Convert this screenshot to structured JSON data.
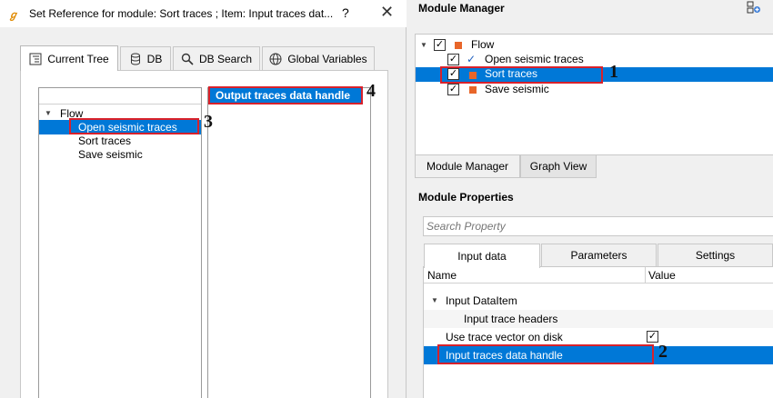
{
  "dialog": {
    "title": "Set Reference for module: Sort traces ; Item: Input traces dat...",
    "help_label": "?",
    "close_label": "✕",
    "tabs": [
      {
        "label": "Current Tree",
        "icon": "tree-icon",
        "active": true
      },
      {
        "label": "DB",
        "icon": "database-icon",
        "active": false
      },
      {
        "label": "DB Search",
        "icon": "search-icon",
        "active": false
      },
      {
        "label": "Global Variables",
        "icon": "globe-icon",
        "active": false
      }
    ],
    "tree": {
      "root": "Flow",
      "items": [
        "Open seismic traces",
        "Sort traces",
        "Save seismic"
      ],
      "selected": "Open seismic traces"
    },
    "handles": {
      "items": [
        "Output traces data handle"
      ],
      "selected": "Output traces data handle"
    }
  },
  "module_manager": {
    "title": "Module Manager",
    "tree": {
      "root": "Flow",
      "items": [
        {
          "label": "Open seismic traces",
          "status": "check"
        },
        {
          "label": "Sort traces",
          "status": "square",
          "selected": true
        },
        {
          "label": "Save seismic",
          "status": "square"
        }
      ]
    },
    "bottom_tabs": [
      {
        "label": "Module Manager",
        "active": true
      },
      {
        "label": "Graph View",
        "active": false
      }
    ]
  },
  "module_properties": {
    "title": "Module Properties",
    "search_placeholder": "Search Property",
    "tabs": [
      {
        "label": "Input data",
        "active": true
      },
      {
        "label": "Parameters",
        "active": false
      },
      {
        "label": "Settings",
        "active": false
      }
    ],
    "columns": [
      "Name",
      "Value"
    ],
    "rows": [
      {
        "name": "Input DataItem",
        "group": true
      },
      {
        "name": "Input trace headers"
      },
      {
        "name": "Use trace vector on disk",
        "checkbox": true
      },
      {
        "name": "Input traces data handle",
        "selected": true
      }
    ]
  },
  "annotations": [
    "1",
    "2",
    "3",
    "4"
  ],
  "colors": {
    "selection": "#0078d7",
    "highlight_box": "#d8212b",
    "status_square": "#e8662a",
    "check": "#1f5fbf"
  }
}
